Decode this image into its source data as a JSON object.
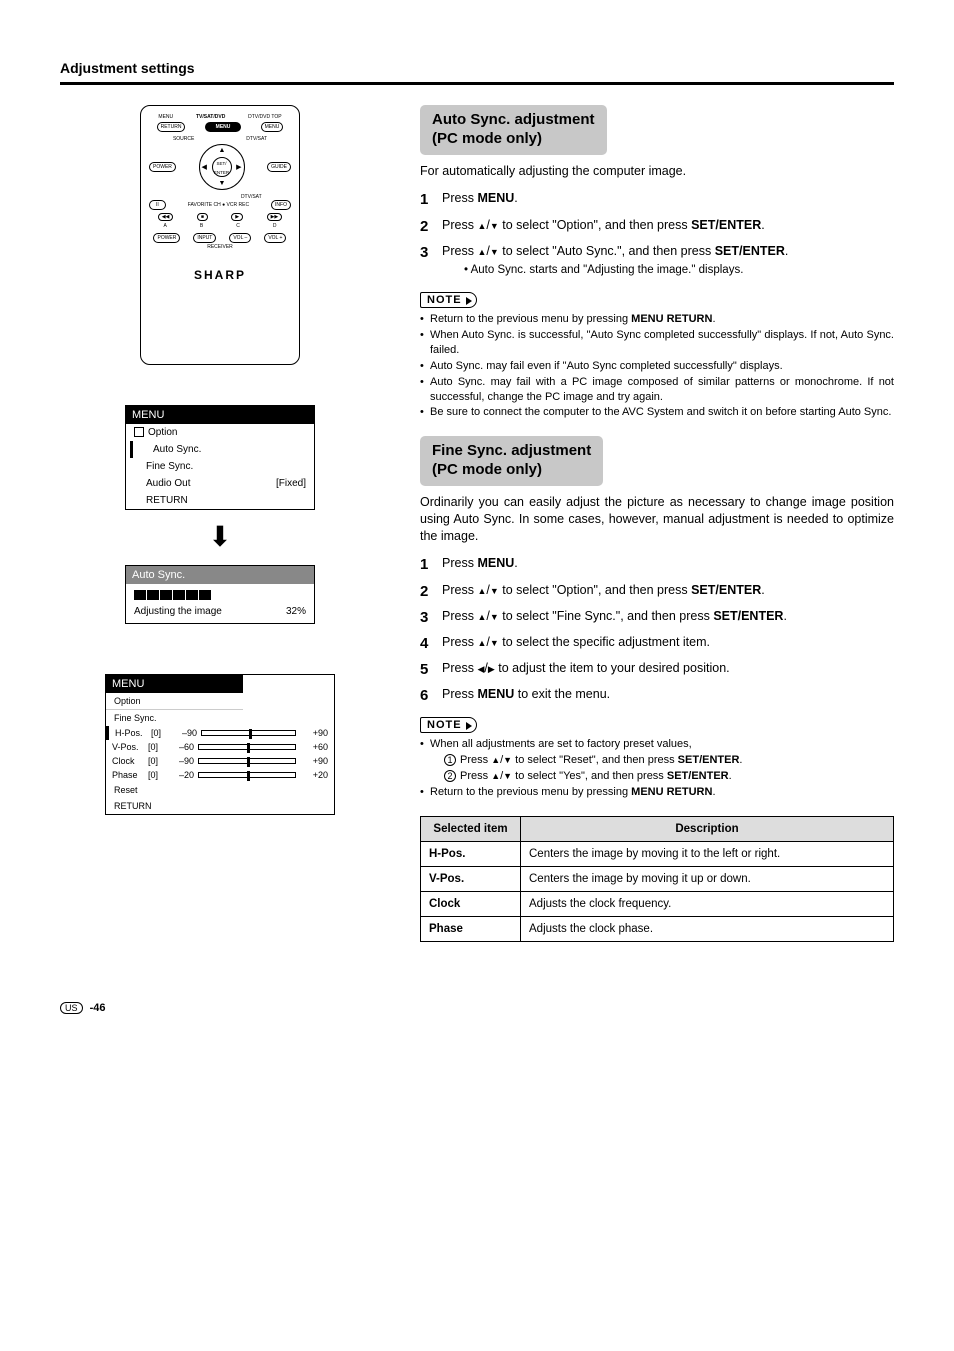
{
  "page": {
    "title": "Adjustment settings",
    "footer_region": "US",
    "footer_page": "-46"
  },
  "remote": {
    "top": {
      "l": "MENU",
      "c": "TV/SAT/DVD",
      "r": "DTV/DVD TOP"
    },
    "row1": {
      "l": "RETURN",
      "c": "MENU",
      "r": "MENU"
    },
    "row2l": "SOURCE",
    "row2r": "DTV/SAT",
    "row3": {
      "l": "POWER",
      "r": "GUIDE"
    },
    "center": "SET/\nENTER",
    "row4r": "DTV/SAT",
    "row5": {
      "l": "II",
      "r": "INFO"
    },
    "fav": "FAVORITE CH",
    "vcr": "VCR REC",
    "abcd_btn": [
      "◀◀",
      "■",
      "▶",
      "▶▶"
    ],
    "abcd": [
      "A",
      "B",
      "C",
      "D"
    ],
    "rec": {
      "a": "POWER",
      "b": "INPUT",
      "c": "VOL –",
      "d": "VOL +",
      "label": "RECEIVER"
    },
    "brand": "SHARP"
  },
  "osd1": {
    "title": "MENU",
    "option": "Option",
    "rows": [
      "Auto Sync.",
      "Fine Sync."
    ],
    "audio_out": "Audio Out",
    "audio_out_val": "[Fixed]",
    "return": "RETURN"
  },
  "osd2": {
    "title": "Auto Sync.",
    "status": "Adjusting the image",
    "pct": "32%"
  },
  "osd3": {
    "title": "MENU",
    "option": "Option",
    "sub": "Fine Sync.",
    "sliders": [
      {
        "name": "H-Pos.",
        "cur": "[0]",
        "min": "–90",
        "max": "+90",
        "pos": 50
      },
      {
        "name": "V-Pos.",
        "cur": "[0]",
        "min": "–60",
        "max": "+60",
        "pos": 50
      },
      {
        "name": "Clock",
        "cur": "[0]",
        "min": "–90",
        "max": "+90",
        "pos": 50
      },
      {
        "name": "Phase",
        "cur": "[0]",
        "min": "–20",
        "max": "+20",
        "pos": 50
      }
    ],
    "reset": "Reset",
    "return": "RETURN"
  },
  "auto_sync": {
    "heading_l1": "Auto Sync. adjustment",
    "heading_l2": "(PC mode only)",
    "intro": "For automatically adjusting the computer image.",
    "steps": {
      "s1_a": "Press ",
      "s1_b": "MENU",
      "s1_c": ".",
      "s2_a": "Press ",
      "s2_b": " to select \"Option\", and then press ",
      "s2_c": "SET/ENTER",
      "s2_d": ".",
      "s3_a": "Press ",
      "s3_b": " to select \"Auto Sync.\", and then press ",
      "s3_c": "SET/ENTER",
      "s3_d": ".",
      "s3_sub": "Auto Sync. starts and \"Adjusting the image.\" displays."
    },
    "note_label": "NOTE",
    "notes": [
      {
        "a": "Return to the previous menu by pressing ",
        "b": "MENU RETURN",
        "c": "."
      },
      {
        "a": "When Auto Sync. is successful, \"Auto Sync completed successfully\" displays. If not, Auto Sync. failed."
      },
      {
        "a": "Auto Sync. may fail even if \"Auto Sync completed successfully\" displays."
      },
      {
        "a": "Auto Sync. may fail with a PC image composed of similar patterns or monochrome. If not successful, change the PC image and try again."
      },
      {
        "a": "Be sure to connect the computer to the AVC System and switch it on before starting Auto Sync."
      }
    ]
  },
  "fine_sync": {
    "heading_l1": "Fine Sync. adjustment",
    "heading_l2": "(PC mode only)",
    "intro": "Ordinarily you can easily adjust the picture as necessary to change image position using Auto Sync. In some cases, however, manual adjustment is needed to optimize the image.",
    "steps": {
      "s1_a": "Press ",
      "s1_b": "MENU",
      "s1_c": ".",
      "s2_a": "Press ",
      "s2_b": " to select \"Option\", and then press ",
      "s2_c": "SET/ENTER",
      "s2_d": ".",
      "s3_a": "Press ",
      "s3_b": " to select \"Fine Sync.\", and then press ",
      "s3_c": "SET/ENTER",
      "s3_d": ".",
      "s4_a": "Press ",
      "s4_b": " to select the specific adjustment item.",
      "s5_a": "Press ",
      "s5_b": " to adjust the item to your desired position.",
      "s6_a": "Press ",
      "s6_b": "MENU",
      "s6_c": " to exit the menu."
    },
    "note_label": "NOTE",
    "notes_intro": "When all adjustments are set to factory preset values,",
    "note1_a": "Press ",
    "note1_b": " to select \"Reset\", and then press ",
    "note1_c": "SET/ENTER",
    "note1_d": ".",
    "note2_a": "Press ",
    "note2_b": " to select \"Yes\", and then press ",
    "note2_c": "SET/ENTER",
    "note2_d": ".",
    "note_return_a": "Return to the previous menu by pressing ",
    "note_return_b": "MENU RETURN",
    "note_return_c": "."
  },
  "table": {
    "h1": "Selected item",
    "h2": "Description",
    "rows": [
      {
        "k": "H-Pos.",
        "v": "Centers the image by moving it to the left or right."
      },
      {
        "k": "V-Pos.",
        "v": "Centers the image by moving it up or down."
      },
      {
        "k": "Clock",
        "v": "Adjusts the clock frequency."
      },
      {
        "k": "Phase",
        "v": "Adjusts the clock phase."
      }
    ]
  }
}
